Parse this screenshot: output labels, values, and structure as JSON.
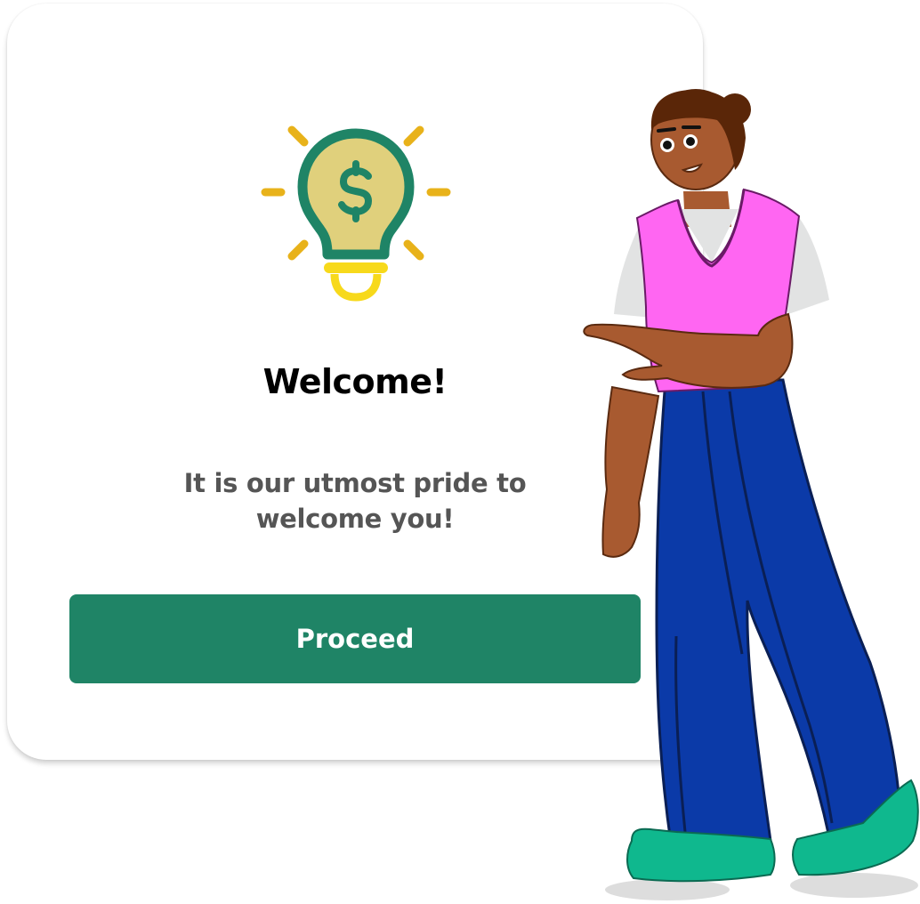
{
  "dialog": {
    "icon": "lightbulb-dollar-icon",
    "title": "Welcome!",
    "message": "It is our utmost pride to welcome you!",
    "proceed_label": "Proceed"
  },
  "illustration": {
    "icon": "person-pointing-illustration"
  },
  "colors": {
    "button": "#1f8466",
    "bulb_outline": "#1f8466",
    "bulb_fill": "#e0d07c",
    "rays": "#e8b21a",
    "bulb_base": "#f7d91b",
    "vest": "#ff66f2",
    "pants": "#0b3aa8",
    "shoes": "#0fb88e",
    "skin": "#a85a30"
  }
}
